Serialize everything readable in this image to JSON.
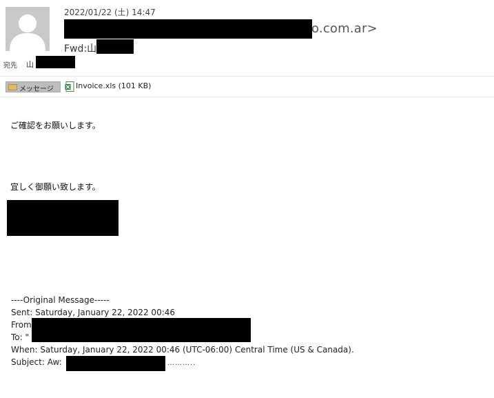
{
  "header": {
    "date": "2022/01/22 (土) 14:47",
    "sender_visible": "o.com.ar>",
    "subject": "Fwd:山",
    "to_label": "宛先",
    "to_value": "山"
  },
  "attachments": {
    "message_tab_label": "メッセージ",
    "file_name": "Invoice.xls (101 KB)",
    "file_icon": "excel-file-icon"
  },
  "body": {
    "line1": "ご確認をお願いします。",
    "line2": "宜しく御願い致します。"
  },
  "original": {
    "separator": "----Original Message-----",
    "sent": "Sent: Saturday, January 22, 2022 00:46",
    "from_label": "From",
    "to_label": "To: \"",
    "when": "When: Saturday, January 22, 2022 00:46 (UTC-06:00) Central Time (US & Canada).",
    "subject_label": "Subject: Aw:",
    "trailing": "……….."
  },
  "icons": {
    "avatar": "user-avatar-icon",
    "message_tab": "envelope-icon"
  },
  "colors": {
    "redaction": "#000000",
    "avatar_bg": "#c9c9c9",
    "tab_bg": "#bdbdbd"
  }
}
